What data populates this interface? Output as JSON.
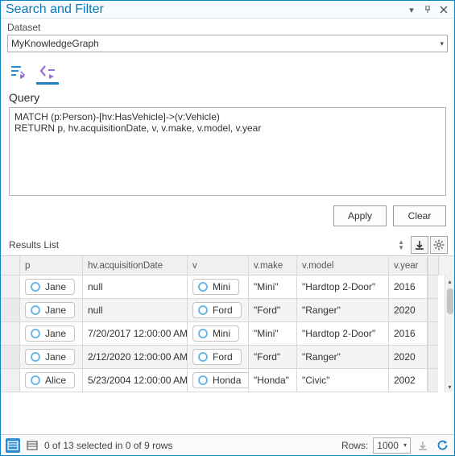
{
  "panel": {
    "title": "Search and Filter"
  },
  "dataset": {
    "label": "Dataset",
    "value": "MyKnowledgeGraph"
  },
  "query": {
    "label": "Query",
    "text": "MATCH (p:Person)-[hv:HasVehicle]->(v:Vehicle)\nRETURN p, hv.acquisitionDate, v, v.make, v.model, v.year"
  },
  "buttons": {
    "apply": "Apply",
    "clear": "Clear"
  },
  "results": {
    "label": "Results List",
    "columns": {
      "p": "p",
      "acq": "hv.acquisitionDate",
      "v": "v",
      "make": "v.make",
      "model": "v.model",
      "year": "v.year"
    },
    "rows": [
      {
        "p": "Jane",
        "acq": "null",
        "v": "Mini",
        "make": "\"Mini\"",
        "model": "\"Hardtop 2-Door\"",
        "year": "2016"
      },
      {
        "p": "Jane",
        "acq": "null",
        "v": "Ford",
        "make": "\"Ford\"",
        "model": "\"Ranger\"",
        "year": "2020"
      },
      {
        "p": "Jane",
        "acq": "7/20/2017 12:00:00 AM",
        "v": "Mini",
        "make": "\"Mini\"",
        "model": "\"Hardtop 2-Door\"",
        "year": "2016"
      },
      {
        "p": "Jane",
        "acq": "2/12/2020 12:00:00 AM",
        "v": "Ford",
        "make": "\"Ford\"",
        "model": "\"Ranger\"",
        "year": "2020"
      },
      {
        "p": "Alice",
        "acq": "5/23/2004 12:00:00 AM",
        "v": "Honda",
        "make": "\"Honda\"",
        "model": "\"Civic\"",
        "year": "2002"
      }
    ]
  },
  "status": {
    "text": "0 of 13 selected in 0 of 9 rows",
    "rows_lbl": "Rows:",
    "rows_value": "1000"
  }
}
